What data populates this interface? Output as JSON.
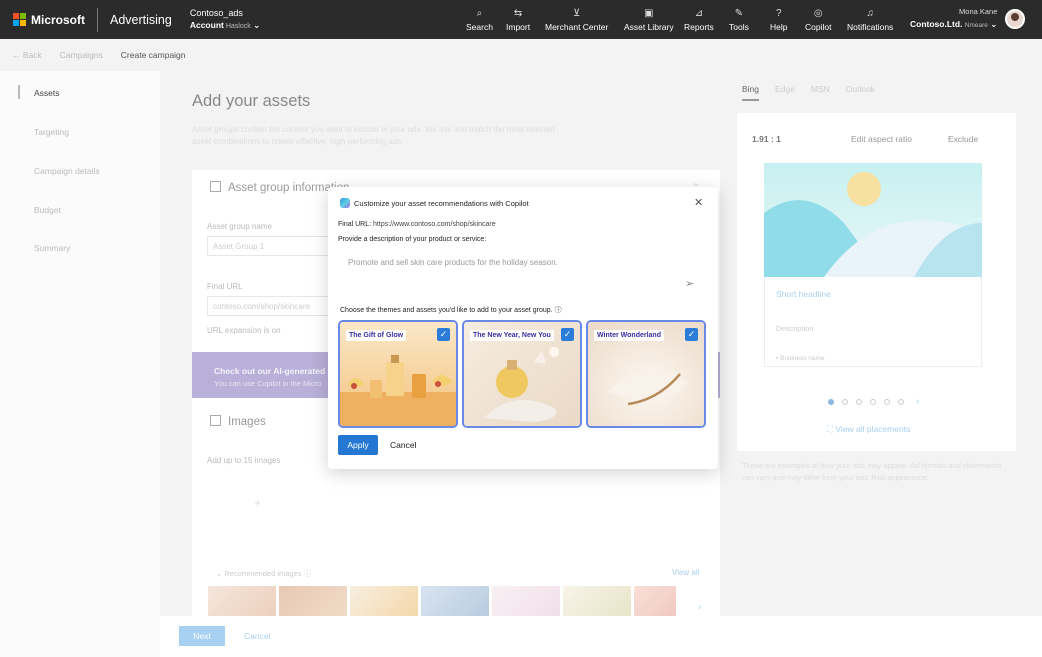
{
  "topbar": {
    "brand": "Microsoft",
    "product": "Advertising",
    "account_name": "Contoso_ads",
    "account_label": "Account",
    "account_suffix": "Haslock",
    "nav": [
      {
        "label": "Search",
        "icon": "search-icon"
      },
      {
        "label": "Import",
        "icon": "import-icon"
      },
      {
        "label": "Merchant Center",
        "icon": "cart-icon"
      },
      {
        "label": "Asset Library",
        "icon": "library-icon"
      },
      {
        "label": "Reports",
        "icon": "chart-icon"
      },
      {
        "label": "Tools",
        "icon": "wrench-icon"
      },
      {
        "label": "Help",
        "icon": "help-icon"
      },
      {
        "label": "Copilot",
        "icon": "copilot-icon"
      },
      {
        "label": "Notifications",
        "icon": "bell-icon"
      }
    ],
    "user_name": "Mona Kane",
    "org": "Contoso.Ltd.",
    "org_suffix": "Nmeare"
  },
  "breadcrumb": {
    "back": "Back",
    "parent": "Campaigns",
    "current": "Create campaign"
  },
  "leftnav": {
    "items": [
      "Assets",
      "Targeting",
      "Campaign details",
      "Budget",
      "Summary"
    ]
  },
  "main": {
    "title": "Add your assets",
    "description": "Asset groups contain the content you want to include in your ads. We mix and match the most relevant asset combinations to create effective, high-performing ads.",
    "asset_group_header": "Asset group information",
    "group_name_label": "Asset group name",
    "group_name_value": "Asset Group 1",
    "final_url_label": "Final URL",
    "final_url_value": "contoso.com/shop/skincare",
    "url_expansion": "URL expansion is on",
    "banner_title": "Check out our AI-generated",
    "banner_sub": "You can use Copilot in the Micro",
    "images_header": "Images",
    "images_sub": "Add up to 15 images",
    "recommended": "Recommended images",
    "view_all": "View all"
  },
  "preview": {
    "tabs": [
      "Bing",
      "Edge",
      "MSN",
      "Outlook"
    ],
    "ratio": "1.91 : 1",
    "edit_ratio": "Edit aspect ratio",
    "exclude": "Exclude",
    "short_headline": "Short headline",
    "description": "Description",
    "business_name": "Business name",
    "view_placements": "View all placements",
    "note": "These are examples of how your ads may appear. Ad formats and placements can vary and may differ from your ads' final appearance."
  },
  "footer": {
    "next": "Next",
    "cancel": "Cancel"
  },
  "modal": {
    "title": "Customize your asset recommendations with Copilot",
    "final_url_label": "Final URL:",
    "final_url": "https://www.contoso.com/shop/skincare",
    "prompt_label": "Provide a description of your product or service:",
    "prompt_value": "Promote and sell skin care products for the holiday season.",
    "choose_label": "Choose the themes and assets you'd like to add to your asset group.",
    "themes": [
      {
        "label": "The Gift of Glow",
        "checked": true
      },
      {
        "label": "The New Year, New You",
        "checked": true
      },
      {
        "label": "Winter Wonderland",
        "checked": true
      }
    ],
    "apply": "Apply",
    "cancel": "Cancel"
  },
  "colors": {
    "topbar": "#2b2b2b",
    "accent": "#2478d4",
    "theme_border": "#6a88e8",
    "theme_label": "#3b2fa0"
  }
}
